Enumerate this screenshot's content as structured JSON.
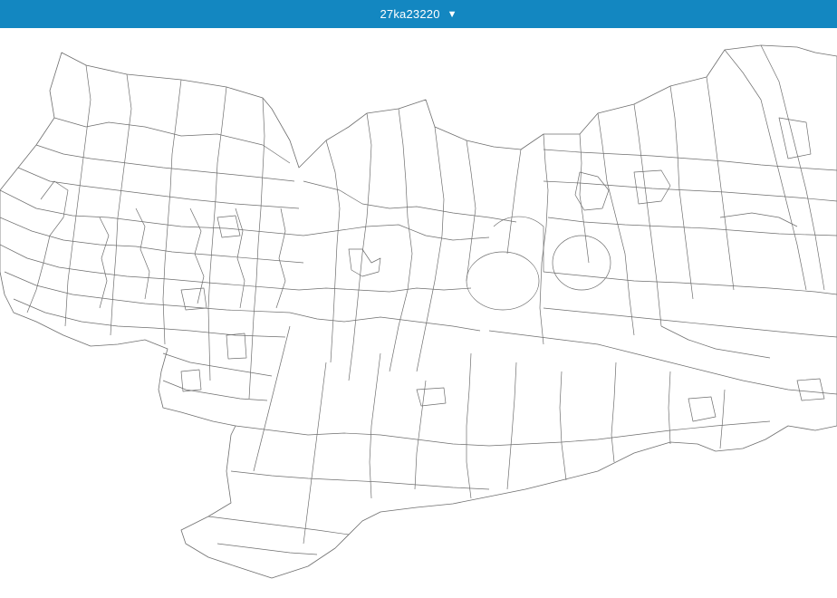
{
  "header": {
    "title": "27ka23220",
    "caret_icon": "triangle-down-icon",
    "caret_glyph": "▼",
    "background_color": "#1387c1",
    "text_color": "#ffffff"
  },
  "map": {
    "stroke_color": "#6e6e6e",
    "fill_color": "#ffffff"
  }
}
